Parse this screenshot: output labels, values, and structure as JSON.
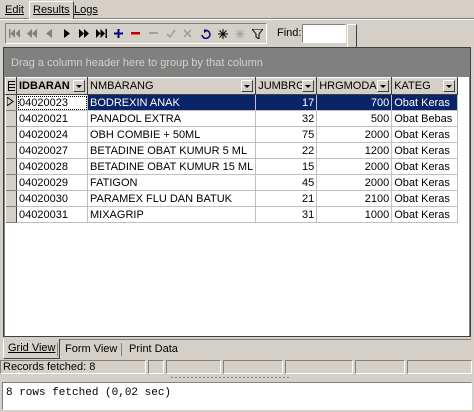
{
  "top_tabs": [
    {
      "label": "Edit",
      "active": false
    },
    {
      "label": "Results",
      "active": true
    },
    {
      "label": "Logs",
      "active": false
    }
  ],
  "toolbar": {
    "buttons": [
      "first-icon",
      "prior-page-icon",
      "prior-icon",
      "next-icon",
      "next-page-icon",
      "last-icon",
      "insert-icon",
      "delete-icon",
      "edit-icon",
      "post-icon",
      "cancel-icon",
      "refresh-icon",
      "snowflake-icon",
      "clear-filter-icon",
      "filter-icon"
    ],
    "find_label": "Find:",
    "find_value": ""
  },
  "grid": {
    "group_hint": "Drag a column header here to group by that column",
    "columns": [
      "IDBARAN",
      "NMBARANG",
      "JUMBRG",
      "HRGMODAL",
      "KATEG"
    ],
    "rows": [
      [
        "04020023",
        "BODREXIN ANAK",
        "17",
        "700",
        "Obat Keras"
      ],
      [
        "04020021",
        "PANADOL EXTRA",
        "32",
        "500",
        "Obat Bebas"
      ],
      [
        "04020024",
        "OBH COMBIE + 50ML",
        "75",
        "2000",
        "Obat Keras"
      ],
      [
        "04020027",
        "BETADINE OBAT KUMUR 5 ML",
        "22",
        "1200",
        "Obat Keras"
      ],
      [
        "04020028",
        "BETADINE OBAT KUMUR 15 ML",
        "15",
        "2000",
        "Obat Keras"
      ],
      [
        "04020029",
        "FATIGON",
        "45",
        "2000",
        "Obat Keras"
      ],
      [
        "04020030",
        "PARAMEX FLU DAN BATUK",
        "21",
        "2100",
        "Obat Keras"
      ],
      [
        "04020031",
        "MIXAGRIP",
        "31",
        "1000",
        "Obat Keras"
      ]
    ],
    "selected_row": 0,
    "selection_color": "#0a246a"
  },
  "view_tabs": [
    {
      "label": "Grid View",
      "active": true
    },
    {
      "label": "Form View",
      "active": false
    },
    {
      "label": "Print Data",
      "active": false
    }
  ],
  "status": {
    "records": "Records fetched: 8"
  },
  "message": "8 rows fetched (0,02 sec)"
}
